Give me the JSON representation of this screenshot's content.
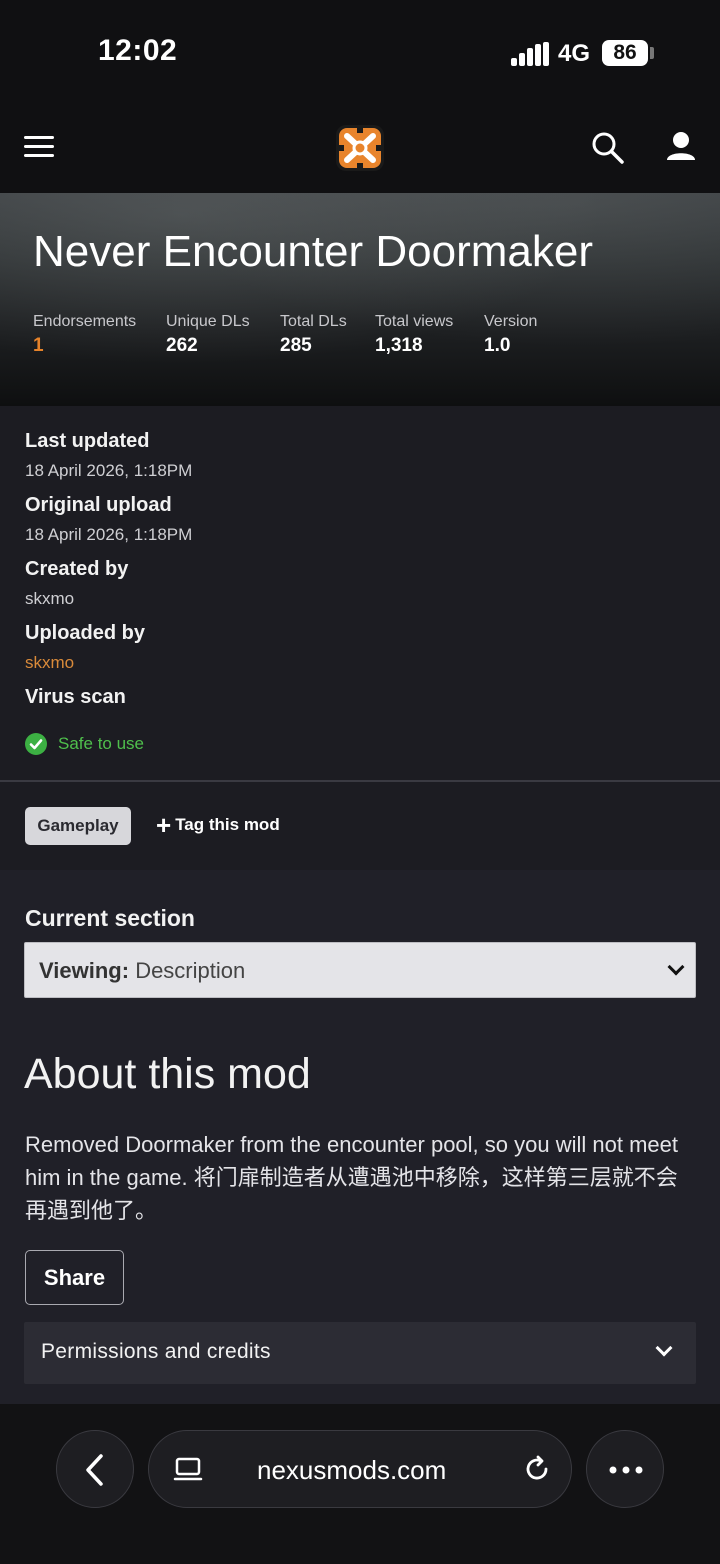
{
  "status_bar": {
    "time": "12:02",
    "network": "4G",
    "battery": "86"
  },
  "nav": {
    "menu_icon": "hamburger-icon",
    "logo_icon": "nexus-logo-icon",
    "search_icon": "search-icon",
    "account_icon": "user-icon"
  },
  "mod": {
    "title": "Never Encounter Doormaker",
    "stats": [
      {
        "label": "Endorsements",
        "value": "1"
      },
      {
        "label": "Unique DLs",
        "value": "262"
      },
      {
        "label": "Total DLs",
        "value": "285"
      },
      {
        "label": "Total views",
        "value": "1,318"
      },
      {
        "label": "Version",
        "value": "1.0"
      }
    ]
  },
  "info": {
    "last_updated_label": "Last updated",
    "last_updated_value": "18 April 2026, 1:18PM",
    "original_upload_label": "Original upload",
    "original_upload_value": "18 April 2026, 1:18PM",
    "created_by_label": "Created by",
    "created_by_value": "skxmo",
    "uploaded_by_label": "Uploaded by",
    "uploaded_by_value": "skxmo",
    "virus_scan_label": "Virus scan",
    "virus_scan_status": "Safe to use"
  },
  "tags": {
    "chip": "Gameplay",
    "add_label": "Tag this mod"
  },
  "section": {
    "label": "Current section",
    "viewing_prefix": "Viewing:",
    "viewing_value": "Description"
  },
  "about": {
    "title": "About this mod",
    "text": "Removed Doormaker from the encounter pool, so you will not meet him in the game. 将门扉制造者从遭遇池中移除，这样第三层就不会再遇到他了。",
    "share_label": "Share",
    "permissions_label": "Permissions and credits"
  },
  "browser": {
    "url": "nexusmods.com"
  },
  "colors": {
    "accent": "#d98a3a",
    "safe": "#3cb043",
    "background": "#202028"
  }
}
